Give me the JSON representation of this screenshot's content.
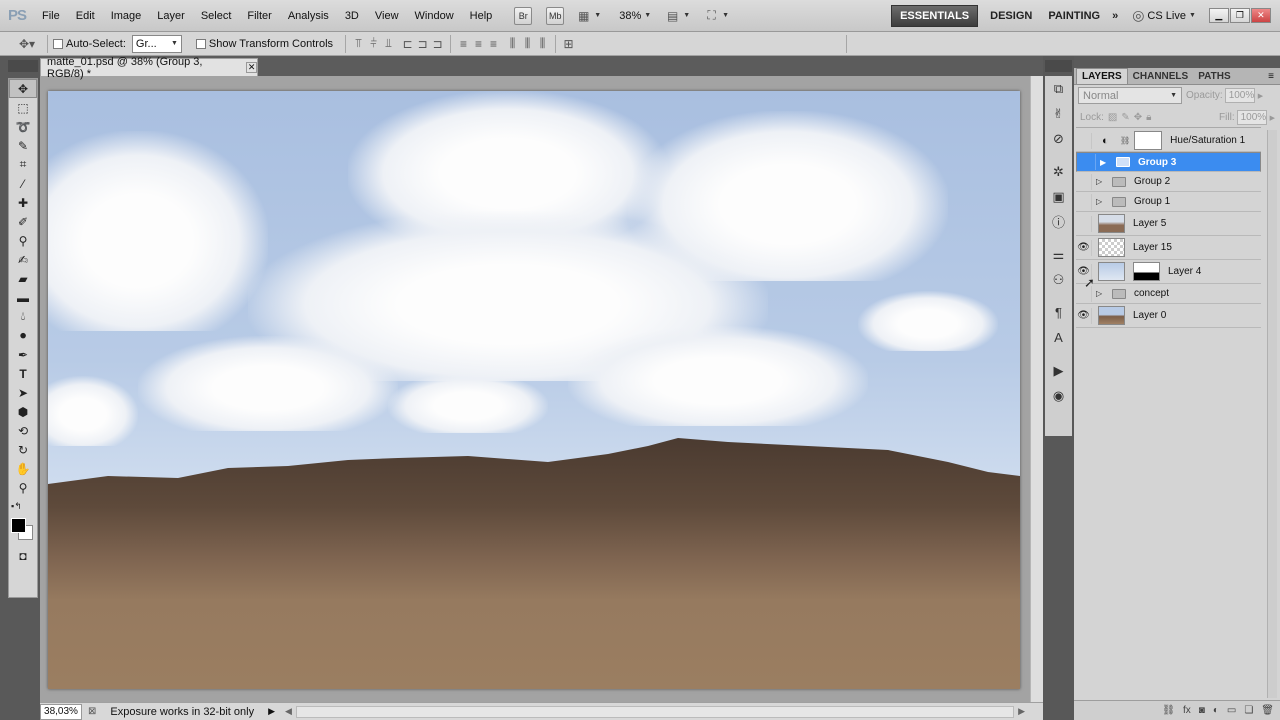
{
  "app": {
    "logo": "PS"
  },
  "menu": [
    "File",
    "Edit",
    "Image",
    "Layer",
    "Select",
    "Filter",
    "Analysis",
    "3D",
    "View",
    "Window",
    "Help"
  ],
  "menubar": {
    "br": "Br",
    "mb": "Mb",
    "zoom": "38%",
    "cslive": "CS Live",
    "workspaces": [
      "ESSENTIALS",
      "DESIGN",
      "PAINTING"
    ],
    "more": "»"
  },
  "options": {
    "auto_select_label": "Auto-Select:",
    "auto_select_value": "Gr...",
    "transform_label": "Show Transform Controls"
  },
  "document": {
    "tab_title": "matte_01.psd @ 38% (Group 3, RGB/8) *"
  },
  "status": {
    "zoom": "38,03%",
    "message": "Exposure works in 32-bit only"
  },
  "panel": {
    "tabs": [
      "LAYERS",
      "CHANNELS",
      "PATHS"
    ],
    "blend_mode": "Normal",
    "opacity_label": "Opacity:",
    "opacity": "100%",
    "lock_label": "Lock:",
    "fill_label": "Fill:",
    "fill": "100%",
    "layers": [
      {
        "name": "Hue/Saturation 1",
        "visible": false,
        "type": "adjustment"
      },
      {
        "name": "Group 3",
        "visible": false,
        "type": "group",
        "selected": true
      },
      {
        "name": "Group 2",
        "visible": false,
        "type": "group"
      },
      {
        "name": "Group 1",
        "visible": false,
        "type": "group"
      },
      {
        "name": "Layer 5",
        "visible": false,
        "type": "image"
      },
      {
        "name": "Layer 15",
        "visible": true,
        "type": "transparent"
      },
      {
        "name": "Layer 4",
        "visible": true,
        "type": "masked"
      },
      {
        "name": "concept",
        "visible": false,
        "type": "group"
      },
      {
        "name": "Layer 0",
        "visible": true,
        "type": "image"
      }
    ]
  },
  "colors": {
    "selection": "#3b8cf0",
    "accent_workspace": "#3d3d3d"
  }
}
